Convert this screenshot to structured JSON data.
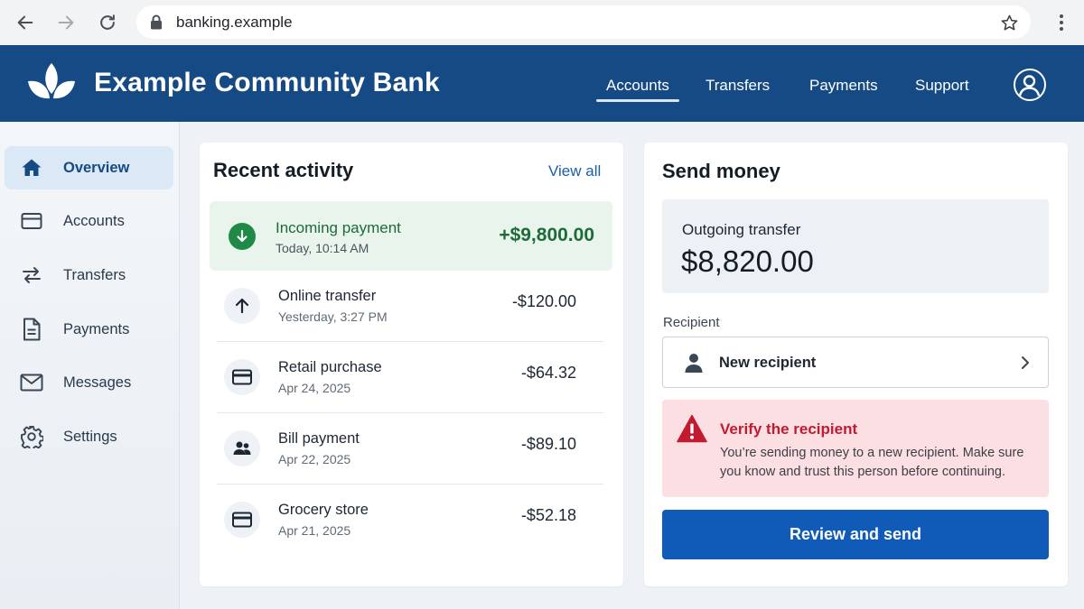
{
  "browser": {
    "url": "banking.example"
  },
  "header": {
    "brand": "Example Community Bank",
    "nav": [
      {
        "label": "Accounts",
        "active": true
      },
      {
        "label": "Transfers",
        "active": false
      },
      {
        "label": "Payments",
        "active": false
      },
      {
        "label": "Support",
        "active": false
      }
    ],
    "brand_color": "#154a85"
  },
  "sidebar": {
    "items": [
      {
        "label": "Overview",
        "icon": "home-icon",
        "active": true
      },
      {
        "label": "Accounts",
        "icon": "card-icon",
        "active": false
      },
      {
        "label": "Transfers",
        "icon": "swap-arrows-icon",
        "active": false
      },
      {
        "label": "Payments",
        "icon": "document-icon",
        "active": false
      },
      {
        "label": "Messages",
        "icon": "envelope-icon",
        "active": false
      },
      {
        "label": "Settings",
        "icon": "gear-icon",
        "active": false
      }
    ]
  },
  "activity": {
    "title": "Recent activity",
    "view_all": "View all",
    "highlight": {
      "name": "Incoming payment",
      "date": "Today, 10:14 AM",
      "amount": "+$9,800.00",
      "icon": "arrow-down-icon",
      "color": "#1f8a46"
    },
    "rows": [
      {
        "name": "Online transfer",
        "date": "Yesterday, 3:27 PM",
        "amount": "-$120.00",
        "icon": "arrow-up-icon"
      },
      {
        "name": "Retail purchase",
        "date": "Apr 24, 2025",
        "amount": "-$64.32",
        "icon": "card-icon"
      },
      {
        "name": "Bill payment",
        "date": "Apr 22, 2025",
        "amount": "-$89.10",
        "icon": "people-icon"
      },
      {
        "name": "Grocery store",
        "date": "Apr 21, 2025",
        "amount": "-$52.18",
        "icon": "card-icon"
      }
    ]
  },
  "send": {
    "title": "Send money",
    "outgoing_label": "Outgoing transfer",
    "outgoing_amount": "$8,820.00",
    "recipient_label": "Recipient",
    "recipient_value": "New recipient",
    "warning": {
      "title": "Verify the recipient",
      "body": "You’re sending money to a new recipient. Make sure you know and trust this person before continuing.",
      "color": "#c21a30"
    },
    "button": "Review and send",
    "button_color": "#115bb8"
  }
}
